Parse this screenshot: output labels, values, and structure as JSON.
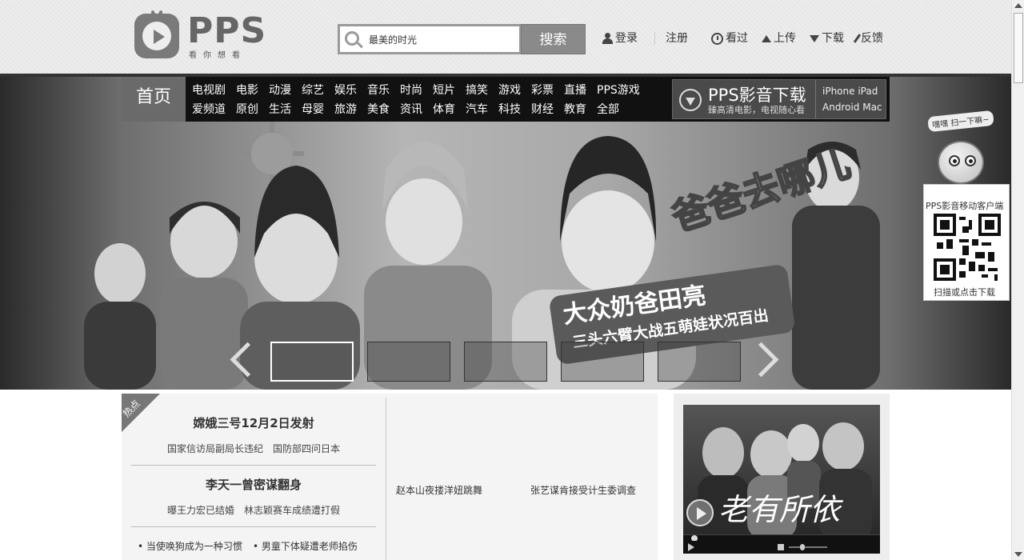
{
  "header": {
    "logo_text": "PPS",
    "logo_slogan": "看你想看",
    "search": {
      "value": "最美的时光",
      "button": "搜索"
    },
    "nav": {
      "login": "登录",
      "register": "注册",
      "history": "看过",
      "upload": "上传",
      "download": "下载",
      "feedback": "反馈"
    }
  },
  "channel_nav": {
    "home": "首页",
    "row1": [
      "电视剧",
      "电影",
      "动漫",
      "综艺",
      "娱乐",
      "音乐",
      "时尚",
      "短片",
      "搞笑",
      "游戏",
      "彩票",
      "直播",
      "PPS游戏"
    ],
    "row2": [
      "爱频道",
      "原创",
      "生活",
      "母婴",
      "旅游",
      "美食",
      "资讯",
      "体育",
      "汽车",
      "科技",
      "财经",
      "教育",
      "全部"
    ]
  },
  "download_promo": {
    "title": "PPS影音下载",
    "subtitle": "臻高清电影，电视随心看",
    "platforms_row1": "iPhone  iPad",
    "platforms_row2": "Android Mac"
  },
  "banner": {
    "show_title": "爸爸去哪儿",
    "headline": "大众奶爸田亮",
    "subline": "三头六臂大战五萌娃状况百出",
    "active_slide": 1,
    "slide_count": 5
  },
  "qr_panel": {
    "bubble": "嘿嘿 扫一下嘛~",
    "title": "PPS影音移动客户端",
    "footer": "扫描或点击下载"
  },
  "hot": {
    "label": "热点",
    "story1": {
      "title": "嫦娥三号12月2日发射",
      "links": [
        "国家信访局副局长违纪",
        "国防部四问日本"
      ]
    },
    "story2": {
      "title": "李天一曾密谋翻身",
      "links": [
        "曝王力宏已结婚",
        "林志颖赛车成绩遭打假"
      ]
    },
    "list": [
      "当使唤狗成为一种习惯",
      "男童下体疑遭老师掐伤"
    ],
    "mid_links": [
      "赵本山夜搂洋妞跳舞",
      "张艺谋肯接受计生委调查"
    ]
  },
  "video": {
    "title": "老有所依"
  },
  "colors": {
    "nav_bg": "#111111",
    "home_bg": "#6a6a6a",
    "search_btn": "#8a8a8a"
  }
}
